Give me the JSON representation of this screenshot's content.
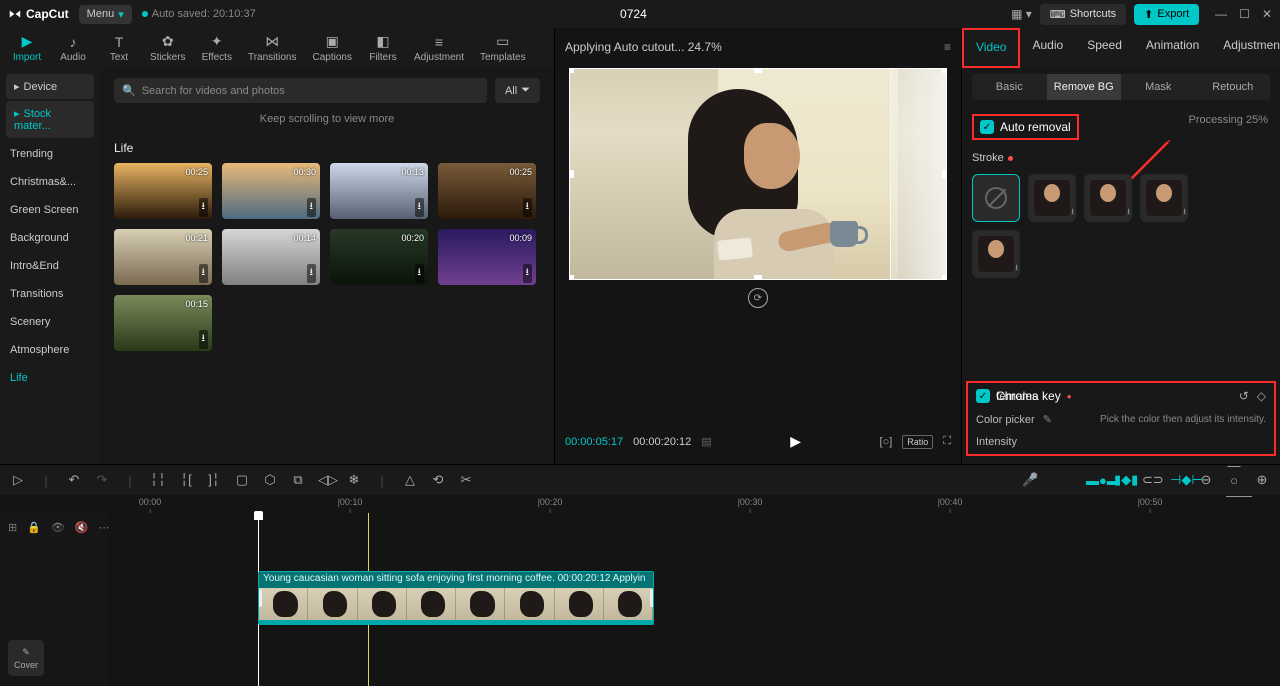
{
  "titlebar": {
    "app_name": "CapCut",
    "menu_label": "Menu",
    "autosaved": "Auto saved: 20:10:37",
    "project_title": "0724",
    "shortcuts": "Shortcuts",
    "export": "Export"
  },
  "tools": [
    {
      "label": "Import",
      "active": true
    },
    {
      "label": "Audio"
    },
    {
      "label": "Text"
    },
    {
      "label": "Stickers"
    },
    {
      "label": "Effects"
    },
    {
      "label": "Transitions"
    },
    {
      "label": "Captions"
    },
    {
      "label": "Filters"
    },
    {
      "label": "Adjustment"
    },
    {
      "label": "Templates"
    }
  ],
  "sidebar": [
    {
      "label": "Device",
      "chip": true
    },
    {
      "label": "Stock mater...",
      "chip": true,
      "active": true
    },
    {
      "label": "Trending"
    },
    {
      "label": "Christmas&..."
    },
    {
      "label": "Green Screen"
    },
    {
      "label": "Background"
    },
    {
      "label": "Intro&End"
    },
    {
      "label": "Transitions"
    },
    {
      "label": "Scenery"
    },
    {
      "label": "Atmosphere"
    },
    {
      "label": "Life",
      "active": true
    }
  ],
  "search": {
    "placeholder": "Search for videos and photos",
    "all": "All"
  },
  "scroll_msg": "Keep scrolling to view more",
  "category_label": "Life",
  "thumbs": [
    {
      "dur": "00:25"
    },
    {
      "dur": "00:30"
    },
    {
      "dur": "00:13"
    },
    {
      "dur": "00:25"
    },
    {
      "dur": "00:21"
    },
    {
      "dur": "00:14"
    },
    {
      "dur": "00:20"
    },
    {
      "dur": "00:09"
    },
    {
      "dur": "00:15"
    }
  ],
  "thumb_bgs": [
    "linear-gradient(180deg,#e8b464,#2a1a0a)",
    "linear-gradient(180deg,#e7b97a,#4d6a80)",
    "linear-gradient(180deg,#cfd8e8,#556070)",
    "linear-gradient(180deg,#7a5a3a,#2a1a0a)",
    "linear-gradient(180deg,#d8d0b6,#7a6a50)",
    "linear-gradient(180deg,#d6d6d6,#808080)",
    "linear-gradient(180deg,#263826,#0a140a)",
    "linear-gradient(180deg,#2a1a60,#704090)",
    "linear-gradient(180deg,#7a8a5a,#2a3a1a)"
  ],
  "preview": {
    "status": "Applying Auto cutout... 24.7%",
    "cur": "00:00:05:17",
    "dur": "00:00:20:12",
    "ratio": "Ratio"
  },
  "rp_tabs": [
    "Video",
    "Audio",
    "Speed",
    "Animation",
    "Adjustment"
  ],
  "rp_sub": [
    "Basic",
    "Remove BG",
    "Mask",
    "Retouch"
  ],
  "auto_removal": "Auto removal",
  "processing": "Processing 25%",
  "stroke": "Stroke",
  "chroma": {
    "title": "Chroma key",
    "picker": "Color picker",
    "hint": "Pick the color then adjust its intensity.",
    "intensity": "Intensity"
  },
  "timeline": {
    "cover": "Cover",
    "clip_label": "Young caucasian woman sitting sofa enjoying first morning coffee.   00:00:20:12   Applyin",
    "ticks": [
      "00:00",
      "|00:10",
      "|00:20",
      "|00:30",
      "|00:40",
      "|00:50"
    ]
  }
}
